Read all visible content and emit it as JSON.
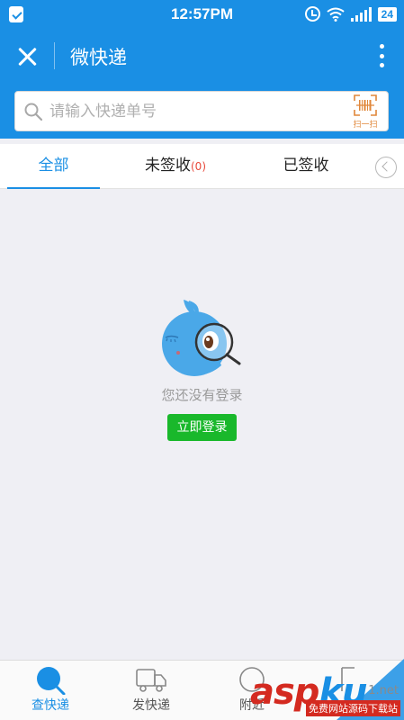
{
  "status_bar": {
    "time": "12:57PM",
    "battery": "24",
    "icons": [
      "app-notification-icon",
      "alarm-icon",
      "wifi-icon",
      "signal-icon",
      "battery-icon"
    ]
  },
  "app_bar": {
    "title": "微快递",
    "icons": [
      "close-icon",
      "more-icon"
    ]
  },
  "search": {
    "placeholder": "请输入快递单号",
    "value": "",
    "scan_label": "扫一扫",
    "icons": [
      "search-icon",
      "barcode-scan-icon"
    ]
  },
  "tabs": [
    {
      "label": "全部",
      "count": "",
      "active": true
    },
    {
      "label": "未签收",
      "count": "(0)",
      "active": false
    },
    {
      "label": "已签收",
      "count": "",
      "active": false
    }
  ],
  "empty_state": {
    "message": "您还没有登录",
    "login_button": "立即登录"
  },
  "bottom_nav": [
    {
      "label": "查快递",
      "icon": "search-parcel-icon",
      "active": true
    },
    {
      "label": "发快递",
      "icon": "delivery-truck-icon",
      "active": false
    },
    {
      "label": "附近",
      "icon": "nearby-icon",
      "active": false
    },
    {
      "label": "",
      "icon": "profile-icon",
      "active": false
    }
  ],
  "watermark": {
    "brand": "asp",
    "brand_suffix": "ku",
    "domain_fragment": "1.net",
    "caption": "免费网站源码下载站"
  },
  "colors": {
    "primary": "#1a8fe4",
    "accent_red": "#e84a3c",
    "button_green": "#19b82b",
    "scan_orange": "#e0873a"
  }
}
